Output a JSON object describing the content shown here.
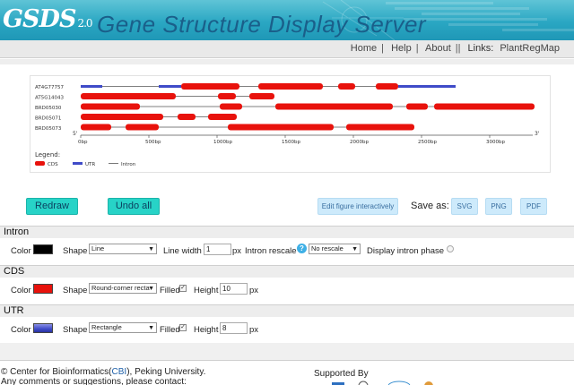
{
  "header": {
    "logo_text": "GSDS",
    "logo_version": "2.0",
    "title": "Gene Structure Display Server"
  },
  "nav": {
    "home": "Home",
    "help": "Help",
    "about": "About",
    "links_label": "Links:",
    "plantregmap": "PlantRegMap",
    "sep1": "|",
    "sep2": "|",
    "sep3": "||"
  },
  "figure": {
    "genes": [
      {
        "name": "AT4G77757"
      },
      {
        "name": "AT5G14043"
      },
      {
        "name": "BRD05030"
      },
      {
        "name": "BRD05071"
      },
      {
        "name": "BRD05073"
      }
    ],
    "five_prime": "5'",
    "three_prime": "3'",
    "scale_labels": [
      "0bp",
      "500bp",
      "1000bp",
      "1500bp",
      "2000bp",
      "2500bp",
      "3000bp"
    ],
    "legend_title": "Legend:",
    "legend_items": [
      {
        "label": "CDS",
        "color": "#e8120c"
      },
      {
        "label": "UTR",
        "color": "#3f4bc8"
      },
      {
        "label": "Intron",
        "color": "#555555"
      }
    ]
  },
  "buttons": {
    "redraw": "Redraw",
    "undo_all": "Undo all",
    "edit_figure": "Edit figure interactively",
    "save_as": "Save as:",
    "svg": "SVG",
    "png": "PNG",
    "pdf": "PDF"
  },
  "intron": {
    "heading": "Intron",
    "color_label": "Color",
    "color": "#000000",
    "shape_label": "Shape",
    "shape_value": "Line",
    "line_width_label": "Line width",
    "line_width_value": "1",
    "px": "px",
    "rescale_label": "Intron rescale",
    "rescale_value": "No rescale",
    "phase_label": "Display intron phase"
  },
  "cds": {
    "heading": "CDS",
    "color_label": "Color",
    "color": "#e8120c",
    "shape_label": "Shape",
    "shape_value": "Round-corner recta",
    "filled_label": "Filled",
    "height_label": "Height",
    "height_value": "10",
    "px": "px"
  },
  "utr": {
    "heading": "UTR",
    "color_label": "Color",
    "color": "#3f4bc8",
    "shape_label": "Shape",
    "shape_value": "Rectangle",
    "filled_label": "Filled",
    "height_label": "Height",
    "height_value": "8",
    "px": "px"
  },
  "footer": {
    "copyright_pre": "© Center for Bioinformatics(",
    "cbi": "CBI",
    "copyright_post": "), Peking University.",
    "contact": "Any comments or suggestions, please contact:",
    "supported_by": "Supported By"
  }
}
